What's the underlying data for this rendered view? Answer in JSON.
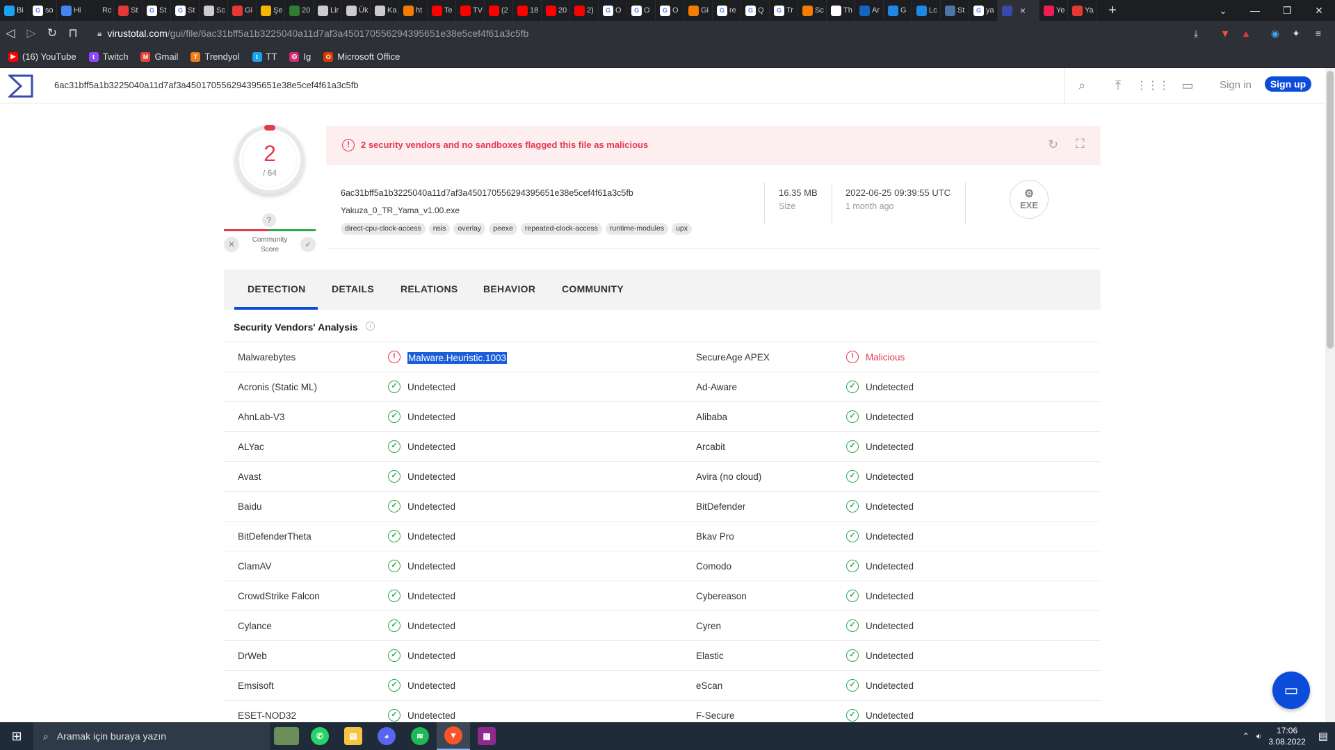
{
  "browser": {
    "tabs": [
      {
        "label": "Bi",
        "icon": "bluebox",
        "color": "#1da1f2"
      },
      {
        "label": "so",
        "icon": "google",
        "color": "#ffffff"
      },
      {
        "label": "Hi",
        "icon": "bars",
        "color": "#4285f4"
      },
      {
        "label": "Rc",
        "icon": "blank",
        "color": "#1c1e22"
      },
      {
        "label": "St",
        "icon": "red",
        "color": "#e53935"
      },
      {
        "label": "St",
        "icon": "google",
        "color": "#ffffff"
      },
      {
        "label": "St",
        "icon": "google",
        "color": "#ffffff"
      },
      {
        "label": "Sc",
        "icon": "github",
        "color": "#cccccc"
      },
      {
        "label": "Gi",
        "icon": "red",
        "color": "#e53935"
      },
      {
        "label": "Şe",
        "icon": "yellow",
        "color": "#f4b400"
      },
      {
        "label": "20",
        "icon": "green",
        "color": "#2e7d32"
      },
      {
        "label": "Lir",
        "icon": "github",
        "color": "#cccccc"
      },
      {
        "label": "Ük",
        "icon": "github",
        "color": "#cccccc"
      },
      {
        "label": "Ka",
        "icon": "github",
        "color": "#cccccc"
      },
      {
        "label": "ht",
        "icon": "orange",
        "color": "#f57c00"
      },
      {
        "label": "Te",
        "icon": "youtube",
        "color": "#ff0000"
      },
      {
        "label": "TV",
        "icon": "youtube",
        "color": "#ff0000"
      },
      {
        "label": "(2",
        "icon": "youtube",
        "color": "#ff0000"
      },
      {
        "label": "18",
        "icon": "youtube",
        "color": "#ff0000"
      },
      {
        "label": "20",
        "icon": "youtube",
        "color": "#ff0000"
      },
      {
        "label": "2)",
        "icon": "youtube",
        "color": "#ff0000"
      },
      {
        "label": "O",
        "icon": "google",
        "color": "#ffffff"
      },
      {
        "label": "O",
        "icon": "google",
        "color": "#ffffff"
      },
      {
        "label": "O",
        "icon": "google",
        "color": "#ffffff"
      },
      {
        "label": "Gi",
        "icon": "orange",
        "color": "#f57c00"
      },
      {
        "label": "re",
        "icon": "google",
        "color": "#ffffff"
      },
      {
        "label": "Q",
        "icon": "google",
        "color": "#ffffff"
      },
      {
        "label": "Tr",
        "icon": "google",
        "color": "#ffffff"
      },
      {
        "label": "Sc",
        "icon": "orange",
        "color": "#f57c00"
      },
      {
        "label": "Th",
        "icon": "amazon",
        "color": "#ffffff"
      },
      {
        "label": "Ar",
        "icon": "blue",
        "color": "#1565c0"
      },
      {
        "label": "G",
        "icon": "blue",
        "color": "#1e88e5"
      },
      {
        "label": "Lc",
        "icon": "blue",
        "color": "#1e88e5"
      },
      {
        "label": "St",
        "icon": "steam",
        "color": "#4a76a8"
      },
      {
        "label": "ya",
        "icon": "google",
        "color": "#ffffff"
      },
      {
        "label": "",
        "icon": "virustotal",
        "color": "#3949ab",
        "active": true
      },
      {
        "label": "Ye",
        "icon": "tiktok",
        "color": "#ee1d52"
      },
      {
        "label": "Ya",
        "icon": "dh",
        "color": "#e53935"
      }
    ],
    "tab_close": "×",
    "new_tab": "+",
    "url_host": "virustotal.com",
    "url_path": "/gui/file/6ac31bff5a1b3225040a11d7af3a450170556294395651e38e5cef4f61a3c5fb",
    "bookmarks": [
      {
        "label": "(16) YouTube",
        "color": "#ff0000",
        "glyph": "▶"
      },
      {
        "label": "Twitch",
        "color": "#9146ff",
        "glyph": "t"
      },
      {
        "label": "Gmail",
        "color": "#ea4335",
        "glyph": "M"
      },
      {
        "label": "Trendyol",
        "color": "#f27a1a",
        "glyph": "T"
      },
      {
        "label": "TT",
        "color": "#1da1f2",
        "glyph": "t"
      },
      {
        "label": "Ig",
        "color": "#d62976",
        "glyph": "◎"
      },
      {
        "label": "Microsoft Office",
        "color": "#d83b01",
        "glyph": "O"
      }
    ]
  },
  "vt": {
    "search_value": "6ac31bff5a1b3225040a11d7af3a450170556294395651e38e5cef4f61a3c5fb",
    "sign_in": "Sign in",
    "sign_up": "Sign up",
    "score": {
      "detected": "2",
      "total": "/ 64"
    },
    "community": {
      "q": "?",
      "label_line1": "Community",
      "label_line2": "Score",
      "x": "✕",
      "check": "✓"
    },
    "alert_text": "2 security vendors and no sandboxes flagged this file as malicious",
    "file": {
      "hash": "6ac31bff5a1b3225040a11d7af3a450170556294395651e38e5cef4f61a3c5fb",
      "name": "Yakuza_0_TR_Yama_v1.00.exe",
      "tags": [
        "direct-cpu-clock-access",
        "nsis",
        "overlay",
        "peexe",
        "repeated-clock-access",
        "runtime-modules",
        "upx"
      ],
      "size_value": "16.35 MB",
      "size_label": "Size",
      "date_value": "2022-06-25 09:39:55 UTC",
      "date_label": "1 month ago",
      "type": "EXE"
    },
    "tabs": [
      "DETECTION",
      "DETAILS",
      "RELATIONS",
      "BEHAVIOR",
      "COMMUNITY"
    ],
    "section_title": "Security Vendors' Analysis",
    "rows": [
      {
        "v1": "Malwarebytes",
        "r1": "Malware.Heuristic.1003",
        "s1": "bad",
        "v2": "SecureAge APEX",
        "r2": "Malicious",
        "s2": "bad"
      },
      {
        "v1": "Acronis (Static ML)",
        "r1": "Undetected",
        "s1": "ok",
        "v2": "Ad-Aware",
        "r2": "Undetected",
        "s2": "ok"
      },
      {
        "v1": "AhnLab-V3",
        "r1": "Undetected",
        "s1": "ok",
        "v2": "Alibaba",
        "r2": "Undetected",
        "s2": "ok"
      },
      {
        "v1": "ALYac",
        "r1": "Undetected",
        "s1": "ok",
        "v2": "Arcabit",
        "r2": "Undetected",
        "s2": "ok"
      },
      {
        "v1": "Avast",
        "r1": "Undetected",
        "s1": "ok",
        "v2": "Avira (no cloud)",
        "r2": "Undetected",
        "s2": "ok"
      },
      {
        "v1": "Baidu",
        "r1": "Undetected",
        "s1": "ok",
        "v2": "BitDefender",
        "r2": "Undetected",
        "s2": "ok"
      },
      {
        "v1": "BitDefenderTheta",
        "r1": "Undetected",
        "s1": "ok",
        "v2": "Bkav Pro",
        "r2": "Undetected",
        "s2": "ok"
      },
      {
        "v1": "ClamAV",
        "r1": "Undetected",
        "s1": "ok",
        "v2": "Comodo",
        "r2": "Undetected",
        "s2": "ok"
      },
      {
        "v1": "CrowdStrike Falcon",
        "r1": "Undetected",
        "s1": "ok",
        "v2": "Cybereason",
        "r2": "Undetected",
        "s2": "ok"
      },
      {
        "v1": "Cylance",
        "r1": "Undetected",
        "s1": "ok",
        "v2": "Cyren",
        "r2": "Undetected",
        "s2": "ok"
      },
      {
        "v1": "DrWeb",
        "r1": "Undetected",
        "s1": "ok",
        "v2": "Elastic",
        "r2": "Undetected",
        "s2": "ok"
      },
      {
        "v1": "Emsisoft",
        "r1": "Undetected",
        "s1": "ok",
        "v2": "eScan",
        "r2": "Undetected",
        "s2": "ok"
      },
      {
        "v1": "ESET-NOD32",
        "r1": "Undetected",
        "s1": "ok",
        "v2": "F-Secure",
        "r2": "Undetected",
        "s2": "ok"
      }
    ],
    "highlighted_result": "Malware.Heuristic.1003"
  },
  "taskbar": {
    "search_placeholder": "Aramak için buraya yazın",
    "apps": [
      {
        "name": "whatsapp",
        "color": "#25d366",
        "glyph": "✆"
      },
      {
        "name": "file-explorer",
        "color": "#f6c343",
        "glyph": "▤"
      },
      {
        "name": "discord",
        "color": "#5865f2",
        "glyph": "◕"
      },
      {
        "name": "spotify",
        "color": "#1db954",
        "glyph": "≋"
      },
      {
        "name": "brave",
        "color": "#fb542b",
        "glyph": "▼",
        "active": true
      },
      {
        "name": "winrar",
        "color": "#8e2a8e",
        "glyph": "▦"
      }
    ],
    "time": "17:06",
    "date": "3.08.2022"
  },
  "colors": {
    "accent": "#0b4dda",
    "malicious": "#e63950",
    "clean": "#2fa84f"
  }
}
